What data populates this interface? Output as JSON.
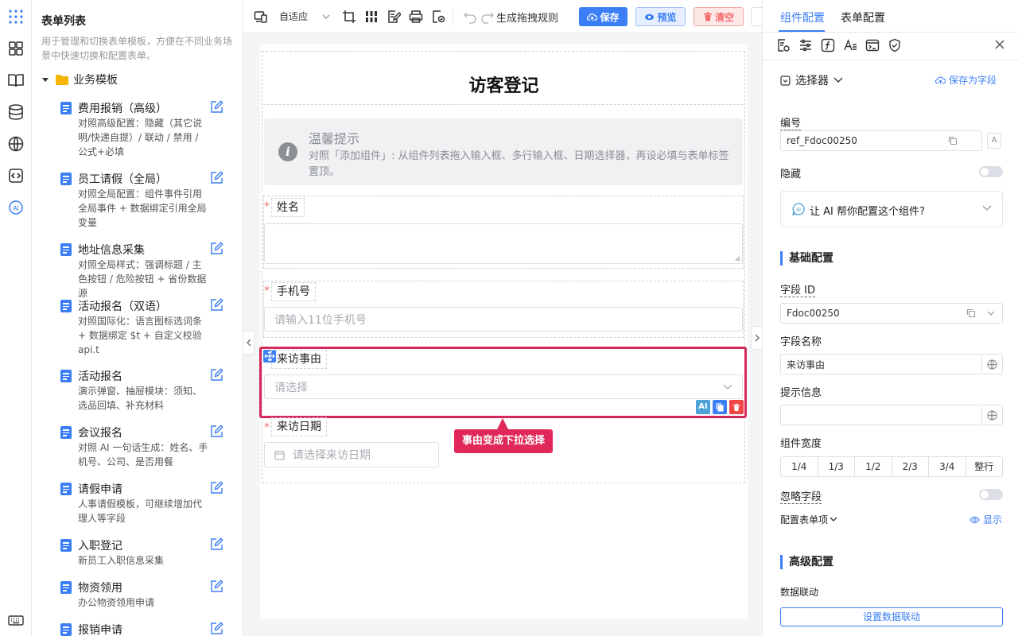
{
  "left_panel": {
    "title": "表单列表",
    "description": "用于管理和切换表单模板，方便在不同业务场景中快速切换和配置表单。",
    "group": "业务模板",
    "templates": [
      {
        "name": "费用报销（高级）",
        "desc": "对照高级配置：隐藏（其它说明/快递自提）/ 联动 / 禁用 / 公式+必填"
      },
      {
        "name": "员工请假（全局）",
        "desc": "对照全局配置：组件事件引用全局事件 + 数据绑定引用全局变量"
      },
      {
        "name": "地址信息采集",
        "desc": "对照全局样式：强调标题 / 主色按钮 / 危险按钮 + 省份数据源"
      },
      {
        "name": "活动报名（双语）",
        "desc": "对照国际化：语言图标选词条 + 数据绑定 $t + 自定义校验 api.t"
      },
      {
        "name": "活动报名",
        "desc": "演示弹窗、抽屉模块：须知、选品回填、补充材料"
      },
      {
        "name": "会议报名",
        "desc": "对照 AI 一句话生成：姓名、手机号、公司、是否用餐"
      },
      {
        "name": "请假申请",
        "desc": "人事请假模板，可继续增加代理人等字段"
      },
      {
        "name": "入职登记",
        "desc": "新员工入职信息采集"
      },
      {
        "name": "物资领用",
        "desc": "办公物资领用申请"
      },
      {
        "name": "报销申请",
        "desc": ""
      }
    ]
  },
  "toolbar": {
    "layout_mode": "自适应",
    "rules_label": "生成拖拽规则",
    "save_label": "保存",
    "preview_label": "预览",
    "clear_label": "清空"
  },
  "form": {
    "title": "访客登记",
    "tip_title": "温馨提示",
    "tip_text": "对照「添加组件」: 从组件列表拖入输入框、多行输入框、日期选择器，再设必填与表单标签置顶。",
    "required_mark": "*",
    "name_label": "姓名",
    "phone_label": "手机号",
    "phone_placeholder": "请输入11位手机号",
    "reason_label": "来访事由",
    "reason_placeholder": "请选择",
    "date_label": "来访日期",
    "date_placeholder": "请选择来访日期",
    "tooltip": "事由变成下拉选择",
    "ai_action": "AI"
  },
  "right_panel": {
    "tabs": [
      "组件配置",
      "表单配置"
    ],
    "component_type": "选择器",
    "save_as_field": "保存为字段",
    "id_label": "编号",
    "id_value": "ref_Fdoc00250",
    "hidden_label": "隐藏",
    "ai_prompt": "让 AI 帮你配置这个组件?",
    "basic_section": "基础配置",
    "field_id_label": "字段 ID",
    "field_id_value": "Fdoc00250",
    "field_name_label": "字段名称",
    "field_name_value": "来访事由",
    "hint_label": "提示信息",
    "hint_value": "",
    "width_label": "组件宽度",
    "width_options": [
      "1/4",
      "1/3",
      "1/2",
      "2/3",
      "3/4",
      "整行"
    ],
    "ignore_label": "忽略字段",
    "config_items_label": "配置表单项",
    "show_label": "显示",
    "advanced_section": "高级配置",
    "linkage_label": "数据联动",
    "linkage_button": "设置数据联动"
  },
  "colors": {
    "primary": "#3b7ef5",
    "danger": "#f56c6c",
    "selected_border": "#d6285a",
    "tooltip_bg": "#e0295a"
  }
}
